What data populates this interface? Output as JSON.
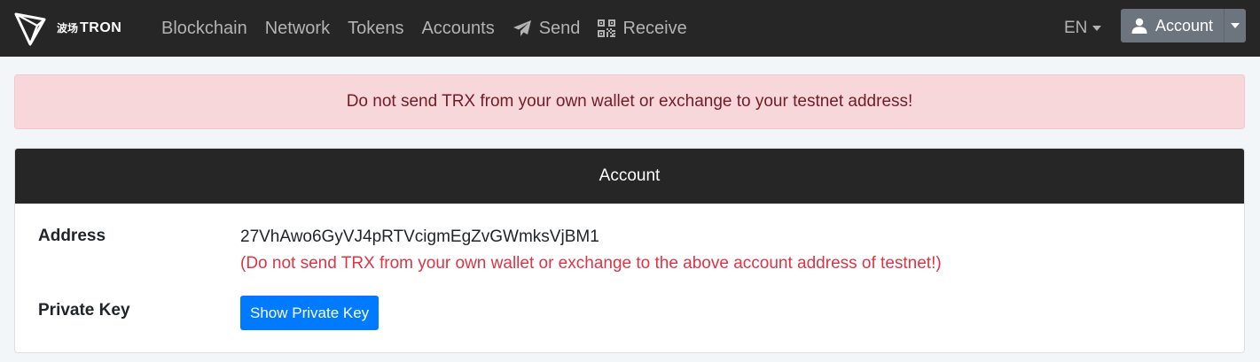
{
  "navbar": {
    "brand_cn": "波场",
    "brand_text": "TRON",
    "links": [
      {
        "label": "Blockchain",
        "icon": ""
      },
      {
        "label": "Network",
        "icon": ""
      },
      {
        "label": "Tokens",
        "icon": ""
      },
      {
        "label": "Accounts",
        "icon": ""
      },
      {
        "label": "Send",
        "icon": "paper-plane-icon"
      },
      {
        "label": "Receive",
        "icon": "qrcode-icon"
      }
    ],
    "language": "EN",
    "account_button": "Account"
  },
  "alert": {
    "message": "Do not send TRX from your own wallet or exchange to your testnet address!"
  },
  "card": {
    "title": "Account",
    "address_label": "Address",
    "address_value": "27VhAwo6GyVJ4pRTVcigmEgZvGWmksVjBM1",
    "address_warning": "(Do not send TRX from your own wallet or exchange to the above account address of testnet!)",
    "private_key_label": "Private Key",
    "show_private_key_button": "Show Private Key"
  },
  "colors": {
    "navbar_bg": "#262626",
    "alert_bg": "#f8d7da",
    "alert_text": "#721c24",
    "warning_text": "#dc3545",
    "primary": "#007bff",
    "secondary": "#6c757d"
  }
}
